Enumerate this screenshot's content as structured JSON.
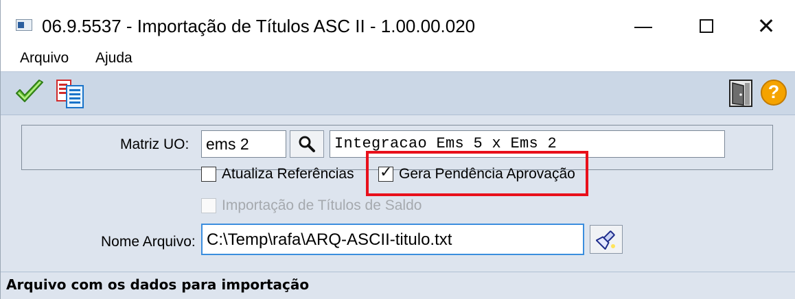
{
  "window": {
    "title": "06.9.5537 - Importação de Títulos ASC II - 1.00.00.020",
    "minimize_glyph": "—",
    "close_glyph": "✕"
  },
  "menu": {
    "items": [
      {
        "label": "Arquivo"
      },
      {
        "label": "Ajuda"
      }
    ]
  },
  "toolbar": {
    "left_icons": [
      "check-icon",
      "copy-icon"
    ],
    "right_icons": [
      "exit-door-icon",
      "help-icon"
    ],
    "help_glyph": "?"
  },
  "form": {
    "matriz_label": "Matriz UO:",
    "matriz_value": "ems 2",
    "matriz_description": "Integracao Ems 5 x Ems 2",
    "atualiza_label": "Atualiza Referências",
    "atualiza_checked": false,
    "gera_label": "Gera Pendência Aprovação",
    "gera_checked": true,
    "importacao_label": "Importação de Títulos de Saldo",
    "importacao_checked": false,
    "importacao_enabled": false,
    "nome_label": "Nome Arquivo:",
    "nome_value": "C:\\Temp\\rafa\\ARQ-ASCII-titulo.txt"
  },
  "status": {
    "text": "Arquivo com os dados para importação"
  },
  "colors": {
    "toolbar_bg": "#cbd7e6",
    "content_bg": "#dde4ee",
    "highlight": "#e8101b",
    "focus_border": "#3a8dde"
  }
}
